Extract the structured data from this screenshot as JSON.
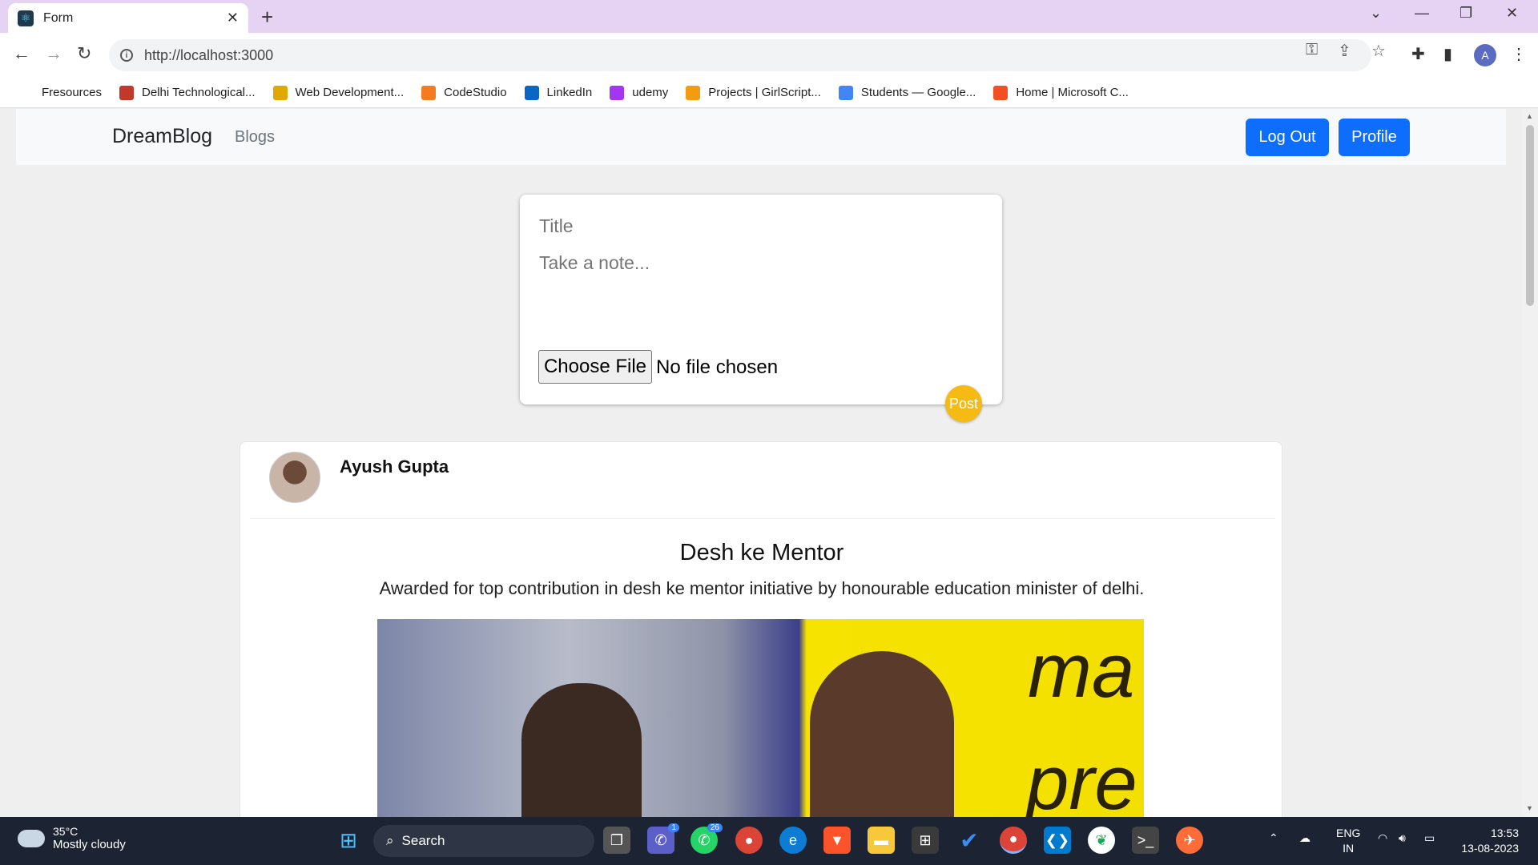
{
  "browser": {
    "tab_title": "Form",
    "url": "http://localhost:3000",
    "bookmarks": [
      {
        "label": "Fresources",
        "icon": "folder-icon",
        "color": "#ffffff"
      },
      {
        "label": "Delhi Technological...",
        "icon": "dtu-logo-icon",
        "color": "#c0392b"
      },
      {
        "label": "Web Development...",
        "icon": "web-dev-icon",
        "color": "#e0a800"
      },
      {
        "label": "CodeStudio",
        "icon": "codestudio-icon",
        "color": "#f47b20"
      },
      {
        "label": "LinkedIn",
        "icon": "linkedin-icon",
        "color": "#0a66c2"
      },
      {
        "label": "udemy",
        "icon": "udemy-icon",
        "color": "#a435f0"
      },
      {
        "label": "Projects | GirlScript...",
        "icon": "girlscript-icon",
        "color": "#f39c12"
      },
      {
        "label": "Students — Google...",
        "icon": "google-icon",
        "color": "#4285f4"
      },
      {
        "label": "Home | Microsoft C...",
        "icon": "microsoft-icon",
        "color": "#f25022"
      }
    ],
    "account_initial": "A"
  },
  "app": {
    "brand": "DreamBlog",
    "nav_link": "Blogs",
    "logout_label": "Log Out",
    "profile_label": "Profile",
    "accent": "#0d6efd"
  },
  "form": {
    "title_placeholder": "Title",
    "note_placeholder": "Take a note...",
    "choose_file_label": "Choose File",
    "file_status": "No file chosen",
    "post_label": "Post",
    "post_color": "#f5ba13"
  },
  "post": {
    "author": "Ayush Gupta",
    "title": "Desh ke Mentor",
    "description": "Awarded for top contribution in desh ke mentor initiative by honourable education minister of delhi.",
    "image_text_1": "ma",
    "image_text_2": "pre"
  },
  "taskbar": {
    "temperature": "35°C",
    "weather": "Mostly cloudy",
    "search_label": "Search",
    "teams_badge": "1",
    "whatsapp_badge": "26",
    "language": "ENG",
    "region": "IN",
    "time": "13:53",
    "date": "13-08-2023"
  }
}
